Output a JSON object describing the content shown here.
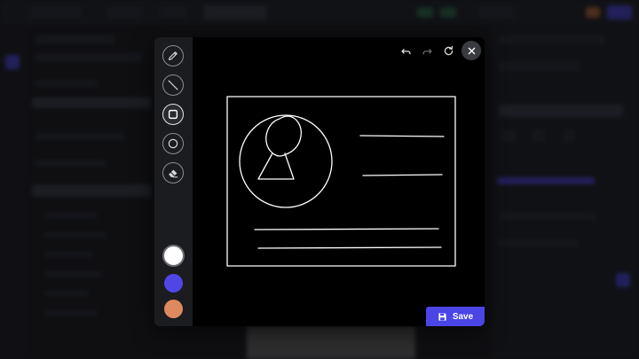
{
  "editor": {
    "tools": [
      {
        "name": "pencil-icon",
        "active": false
      },
      {
        "name": "line-icon",
        "active": false
      },
      {
        "name": "rectangle-icon",
        "active": true
      },
      {
        "name": "circle-icon",
        "active": false
      },
      {
        "name": "eraser-icon",
        "active": false
      }
    ],
    "colors": [
      {
        "name": "white",
        "hex": "#ffffff",
        "selected": true
      },
      {
        "name": "indigo",
        "hex": "#4f46e5",
        "selected": false
      },
      {
        "name": "orange",
        "hex": "#de8a5e",
        "selected": false
      }
    ],
    "actions": [
      "undo-icon",
      "redo-icon",
      "refresh-icon",
      "close-icon"
    ],
    "save_label": "Save",
    "accent": "#4b45e6",
    "stroke_color": "#ffffff"
  }
}
